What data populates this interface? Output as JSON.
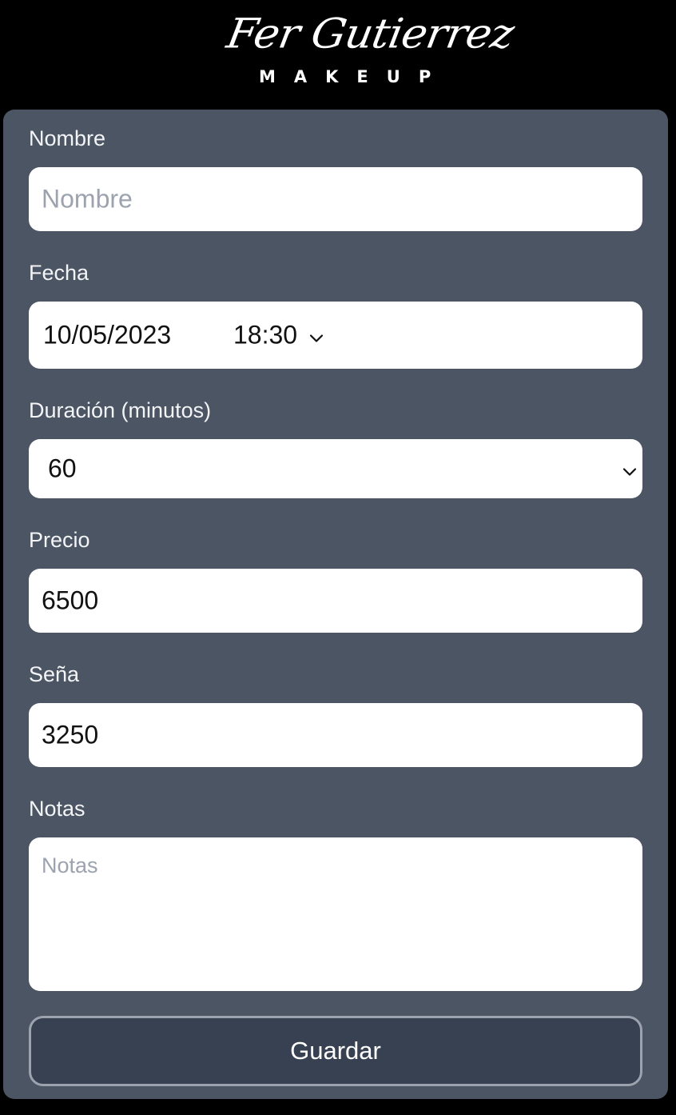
{
  "brand": {
    "script_name": "Fer Gutierrez",
    "sub_name": "MAKEUP"
  },
  "form": {
    "nombre": {
      "label": "Nombre",
      "placeholder": "Nombre",
      "value": ""
    },
    "fecha": {
      "label": "Fecha",
      "date_value": "10/05/2023",
      "time_value": "18:30"
    },
    "duracion": {
      "label": "Duración (minutos)",
      "selected": "60"
    },
    "precio": {
      "label": "Precio",
      "value": "6500"
    },
    "sena": {
      "label": "Seña",
      "value": "3250"
    },
    "notas": {
      "label": "Notas",
      "placeholder": "Notas",
      "value": ""
    },
    "submit_label": "Guardar"
  },
  "colors": {
    "page_background": "#000000",
    "card_background": "#4b5563",
    "input_background": "#ffffff",
    "button_background": "#374151",
    "button_border": "#9ca3af",
    "placeholder": "#9ca3af"
  },
  "icons": {
    "time_dropdown": "chevron-down-icon",
    "select_dropdown": "chevron-down-icon"
  }
}
